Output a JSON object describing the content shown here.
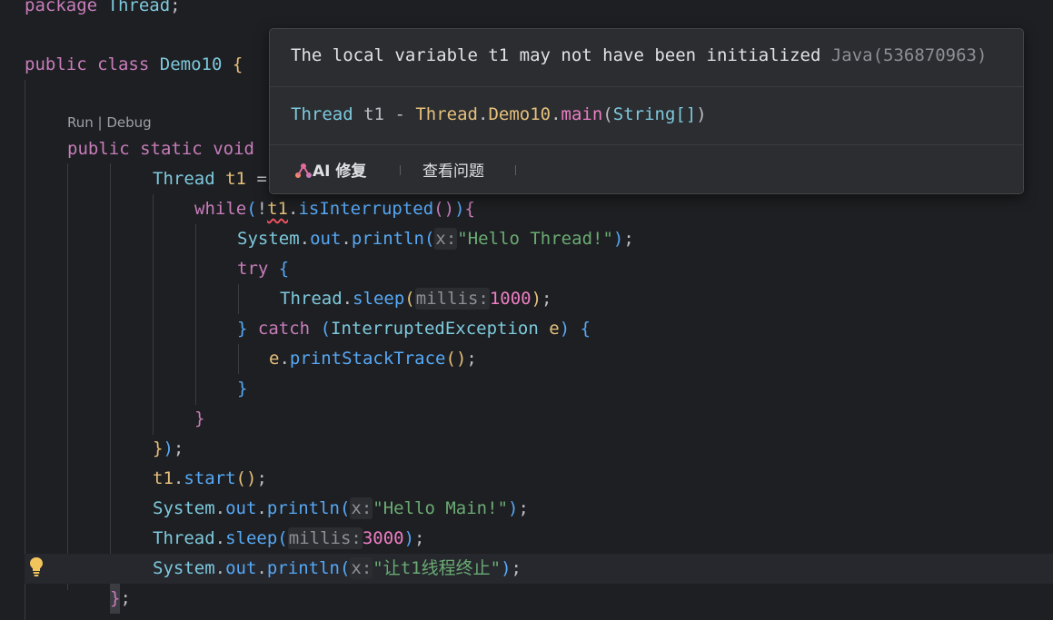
{
  "code": {
    "line_package": {
      "kw": "package",
      "name": "Thread",
      "semi": ";"
    },
    "line_class": {
      "kw1": "public",
      "kw2": "class",
      "name": "Demo10",
      "brace": "{"
    },
    "codelens": "Run | Debug",
    "line_main": {
      "kw1": "public",
      "kw2": "static",
      "kw3": "void"
    },
    "line_thread": {
      "type": "Thread",
      "var": "t1",
      "eq": "="
    },
    "line_while": {
      "kw": "while",
      "open": "(",
      "bang": "!",
      "var": "t1",
      "dot": ".",
      "method": "isInterrupted",
      "paren": "()",
      "close": ")",
      "brace": "{"
    },
    "line_print1": {
      "cls": "System",
      "dot1": ".",
      "field": "out",
      "dot2": ".",
      "method": "println",
      "open": "(",
      "hint": "x:",
      "str": "\"Hello Thread!\"",
      "close": ")",
      "semi": ";"
    },
    "line_try": {
      "kw": "try",
      "brace": "{"
    },
    "line_sleep1": {
      "cls": "Thread",
      "dot": ".",
      "method": "sleep",
      "open": "(",
      "hint": "millis:",
      "num": "1000",
      "close": ")",
      "semi": ";"
    },
    "line_catch": {
      "close_brace": "}",
      "kw": "catch",
      "open": "(",
      "type": "InterruptedException",
      "var": "e",
      "close": ")",
      "brace": "{"
    },
    "line_trace": {
      "var": "e",
      "dot": ".",
      "method": "printStackTrace",
      "paren": "()",
      "semi": ";"
    },
    "line_close_catch": "}",
    "line_close_while": "}",
    "line_close_lambda": {
      "brace": "}",
      "paren": ")",
      "semi": ";"
    },
    "line_start": {
      "var": "t1",
      "dot": ".",
      "method": "start",
      "paren": "()",
      "semi": ";"
    },
    "line_print2": {
      "cls": "System",
      "dot1": ".",
      "field": "out",
      "dot2": ".",
      "method": "println",
      "open": "(",
      "hint": "x:",
      "str": "\"Hello Main!\"",
      "close": ")",
      "semi": ";"
    },
    "line_sleep2": {
      "cls": "Thread",
      "dot": ".",
      "method": "sleep",
      "open": "(",
      "hint": "millis:",
      "num": "3000",
      "close": ")",
      "semi": ";"
    },
    "line_print3": {
      "cls": "System",
      "dot1": ".",
      "field": "out",
      "dot2": ".",
      "method": "println",
      "open": "(",
      "hint": "x:",
      "str": "\"让t1线程终止\"",
      "close": ")",
      "semi": ";"
    },
    "line_close_main": {
      "brace": "}",
      "semi": ";"
    }
  },
  "popup": {
    "message": "The local variable t1 may not have been initialized",
    "code": "Java(536870963)",
    "signature": {
      "type": "Thread",
      "name": "t1",
      "dash": "-",
      "owner_pkg": "Thread",
      "dot1": ".",
      "owner_cls": "Demo10",
      "dot2": ".",
      "method": "main",
      "open": "(",
      "param_type": "String[]",
      "close": ")"
    },
    "actions": {
      "ai_fix": "AI 修复",
      "view_problem": "查看问题"
    }
  },
  "icons": {
    "lightbulb": "lightbulb-icon",
    "ai": "ai-sparkle-icon"
  }
}
